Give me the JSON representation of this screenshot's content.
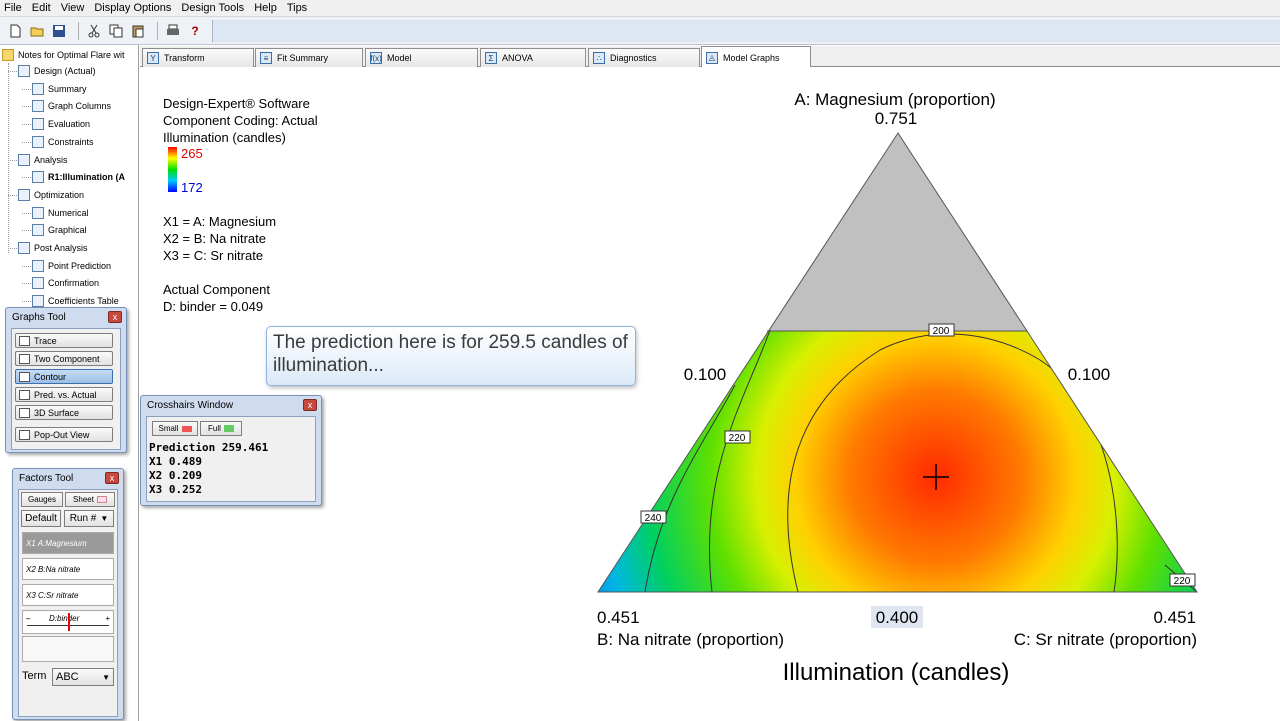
{
  "menu": [
    "File",
    "Edit",
    "View",
    "Display Options",
    "Design Tools",
    "Help",
    "Tips"
  ],
  "toolbar": {
    "icons": [
      "new-icon",
      "open-icon",
      "save-icon",
      "cut-icon",
      "copy-icon",
      "paste-icon",
      "print-icon",
      "help-icon",
      "tip-icon"
    ],
    "help_glyph": "?",
    "tip_glyph": "☼"
  },
  "tree": {
    "root": "Notes for Optimal Flare wit",
    "items": [
      {
        "label": "Design (Actual)",
        "level": 1
      },
      {
        "label": "Summary",
        "level": 2
      },
      {
        "label": "Graph Columns",
        "level": 2
      },
      {
        "label": "Evaluation",
        "level": 2
      },
      {
        "label": "Constraints",
        "level": 2
      },
      {
        "label": "Analysis",
        "level": 1
      },
      {
        "label": "R1:Illumination (A",
        "level": 2,
        "bold": true
      },
      {
        "label": "Optimization",
        "level": 1
      },
      {
        "label": "Numerical",
        "level": 2
      },
      {
        "label": "Graphical",
        "level": 2
      },
      {
        "label": "Post Analysis",
        "level": 1
      },
      {
        "label": "Point Prediction",
        "level": 2
      },
      {
        "label": "Confirmation",
        "level": 2
      },
      {
        "label": "Coefficients Table",
        "level": 2
      }
    ]
  },
  "tabs": [
    {
      "label": "Transform",
      "icon": "transform-icon",
      "glyph": "Y"
    },
    {
      "label": "Fit Summary",
      "icon": "fit-summary-icon",
      "glyph": "≡"
    },
    {
      "label": "Model",
      "icon": "model-icon",
      "glyph": "f(x)"
    },
    {
      "label": "ANOVA",
      "icon": "anova-icon",
      "glyph": "Σ"
    },
    {
      "label": "Diagnostics",
      "icon": "diagnostics-icon",
      "glyph": "∴"
    },
    {
      "label": "Model Graphs",
      "icon": "model-graphs-icon",
      "glyph": "◬",
      "active": true
    }
  ],
  "legend": {
    "software": "Design-Expert® Software",
    "coding": "Component Coding: Actual",
    "response": "Illumination (candles)",
    "max": "265",
    "min": "172",
    "x1": "X1 = A: Magnesium",
    "x2": "X2 = B: Na nitrate",
    "x3": "X3 = C: Sr nitrate",
    "actual_title": "Actual Component",
    "actual_value": "D: binder = 0.049"
  },
  "callout": "The prediction here is for 259.5 candles of illumination...",
  "graphs_tool": {
    "title": "Graphs Tool",
    "close": "x",
    "buttons": [
      "Trace",
      "Two Component",
      "Contour",
      "Pred. vs. Actual",
      "3D Surface",
      "Pop-Out View"
    ],
    "active": "Contour"
  },
  "crosshairs": {
    "title": "Crosshairs Window",
    "close": "x",
    "small": "Small",
    "full": "Full",
    "prediction": "Prediction 259.461",
    "x1": "X1 0.489",
    "x2": "X2 0.209",
    "x3": "X3 0.252"
  },
  "factors_tool": {
    "title": "Factors Tool",
    "close": "x",
    "gauges": "Gauges",
    "sheet": "Sheet",
    "default": "Default",
    "run": "Run #",
    "factors": [
      "X1  A:Magnesium",
      "X2  B:Na nitrate",
      "X3  C:Sr nitrate"
    ],
    "binder": "D:binder",
    "minus": "–",
    "plus": "+",
    "term_label": "Term",
    "term_value": "ABC",
    "binder_level": 0.49
  },
  "chart_data": {
    "type": "ternary-contour",
    "title": "Illumination (candles)",
    "top_axis": "A: Magnesium (proportion)",
    "top_value": "0.751",
    "left_axis": "B: Na nitrate (proportion)",
    "right_axis": "C: Sr nitrate (proportion)",
    "left_vertex": "0.451",
    "right_vertex": "0.451",
    "bottom_center": "0.400",
    "left_mid": "0.100",
    "right_mid": "0.100",
    "contours": [
      "200",
      "220",
      "240",
      "220"
    ],
    "crosshair": {
      "A": 0.489,
      "B": 0.209,
      "C": 0.252,
      "prediction": 259.461
    },
    "color_range": [
      172,
      265
    ],
    "colors": {
      "high": "#ff0000",
      "mid": "#ffff00",
      "low_mid": "#00e000",
      "low": "#00a0ff",
      "infeasible": "#c0c0c0"
    }
  }
}
